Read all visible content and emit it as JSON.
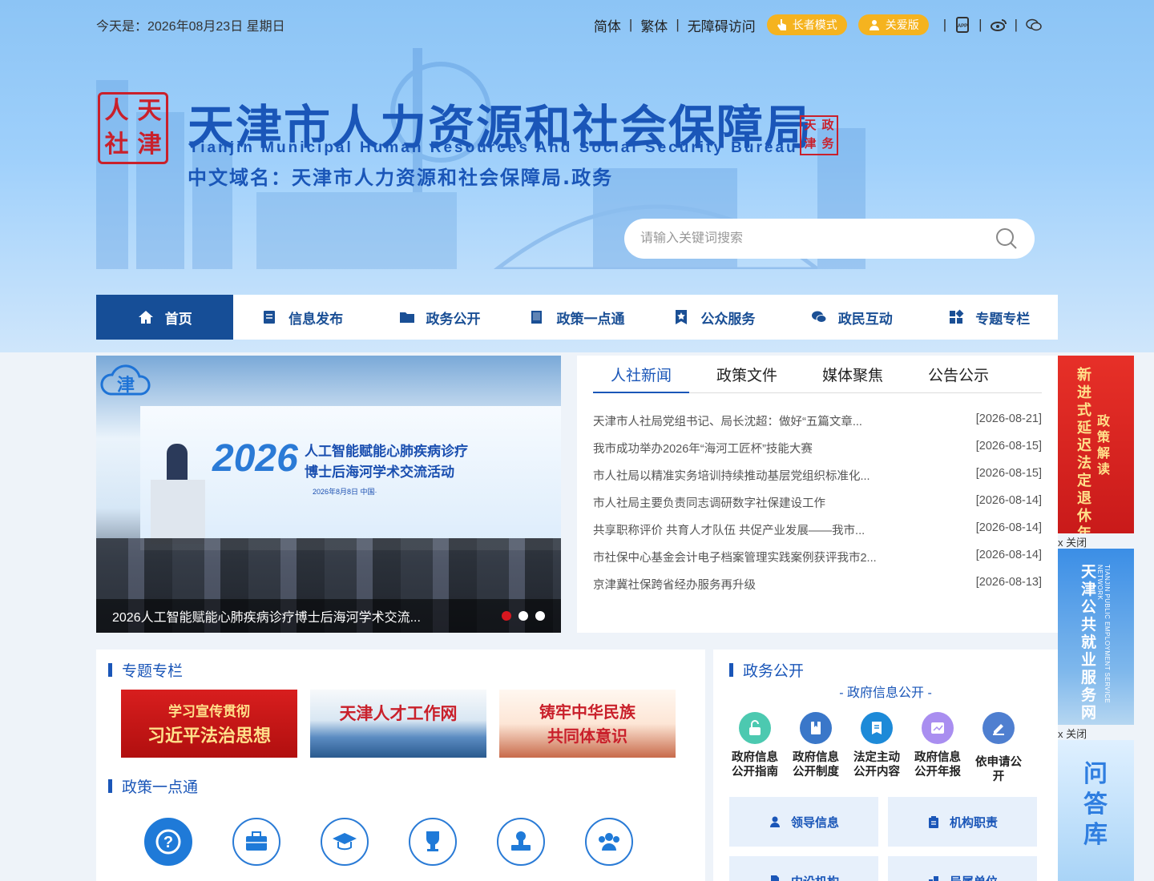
{
  "topbar": {
    "date": "今天是：2026年08月23日 星期日",
    "links": [
      "简体",
      "繁体",
      "无障碍访问"
    ],
    "elder_mode": "长者模式",
    "care_version": "关爱版"
  },
  "header": {
    "seal_chars": [
      "人",
      "天",
      "社",
      "津"
    ],
    "title": "天津市人力资源和社会保障局",
    "title_en": "Tianjin Municipal Human Resources And Social Security Bureau",
    "domain": "中文域名：天津市人力资源和社会保障局.政务",
    "stamp_chars": [
      "天",
      "政",
      "津",
      "务"
    ]
  },
  "search": {
    "placeholder": "请输入关键词搜索"
  },
  "nav": {
    "items": [
      {
        "label": "首页",
        "icon": "home-icon"
      },
      {
        "label": "信息发布",
        "icon": "document-icon"
      },
      {
        "label": "政务公开",
        "icon": "folder-icon"
      },
      {
        "label": "政策一点通",
        "icon": "book-icon"
      },
      {
        "label": "公众服务",
        "icon": "star-badge-icon"
      },
      {
        "label": "政民互动",
        "icon": "chat-icon"
      },
      {
        "label": "专题专栏",
        "icon": "grid-icon"
      }
    ]
  },
  "slider": {
    "screen_year": "2026",
    "screen_line1": "人工智能赋能心肺疾病诊疗",
    "screen_line2": "博士后海河学术交流活动",
    "screen_date": "2026年8月8日   中国·",
    "caption": "2026人工智能赋能心肺疾病诊疗博士后海河学术交流...",
    "logo_char": "津"
  },
  "news": {
    "tabs": [
      "人社新闻",
      "政策文件",
      "媒体聚焦",
      "公告公示"
    ],
    "items": [
      {
        "title": "天津市人社局党组书记、局长沈超：做好“五篇文章...",
        "date": "[2026-08-21]"
      },
      {
        "title": "我市成功举办2026年“海河工匠杯”技能大赛",
        "date": "[2026-08-15]"
      },
      {
        "title": "市人社局以精准实务培训持续推动基层党组织标准化...",
        "date": "[2026-08-15]"
      },
      {
        "title": "市人社局主要负责同志调研数字社保建设工作",
        "date": "[2026-08-14]"
      },
      {
        "title": "共享职称评价 共育人才队伍 共促产业发展——我市...",
        "date": "[2026-08-14]"
      },
      {
        "title": "市社保中心基金会计电子档案管理实践案例获评我市2...",
        "date": "[2026-08-14]"
      },
      {
        "title": "京津冀社保跨省经办服务再升级",
        "date": "[2026-08-13]"
      }
    ]
  },
  "side_ads": {
    "ad1_main": "新进式延迟法定退休年龄",
    "ad1_sub": "政策解读",
    "ad2_main": "天津公共就业服务网",
    "ad2_sub": "TIANJIN PUBLIC EMPLOYMENT SERVICE NETWORK",
    "ad3_main": "问答库",
    "close_label": "x  关闭"
  },
  "special": {
    "title": "专题专栏",
    "banners": [
      {
        "line1": "学习宣传贯彻",
        "line2": "习近平法治思想"
      },
      {
        "line1": "天津人才工作网"
      },
      {
        "line1": "铸牢中华民族",
        "line2": "共同体意识"
      }
    ]
  },
  "policy": {
    "title": "政策一点通",
    "items": [
      {
        "icon": "question-icon"
      },
      {
        "icon": "briefcase-icon"
      },
      {
        "icon": "graduation-cap-icon"
      },
      {
        "icon": "trophy-icon"
      },
      {
        "icon": "stamp-icon"
      },
      {
        "icon": "people-group-icon"
      }
    ]
  },
  "gov": {
    "title": "政务公开",
    "subtitle": "- 政府信息公开 -",
    "items": [
      {
        "label1": "政府信息",
        "label2": "公开指南",
        "color": "#4cc9b0",
        "icon": "lock-open-icon"
      },
      {
        "label1": "政府信息",
        "label2": "公开制度",
        "color": "#3a77c9",
        "icon": "book-mark-icon"
      },
      {
        "label1": "法定主动",
        "label2": "公开内容",
        "color": "#1d8ad8",
        "icon": "list-doc-icon"
      },
      {
        "label1": "政府信息",
        "label2": "公开年报",
        "color": "#a98ef0",
        "icon": "chart-doc-icon"
      },
      {
        "label1": "依申请公开",
        "label2": "",
        "color": "#4f7fd0",
        "icon": "pen-icon"
      }
    ],
    "buttons": [
      {
        "label": "领导信息",
        "icon": "user-icon"
      },
      {
        "label": "机构职责",
        "icon": "clipboard-icon"
      },
      {
        "label": "内设机构",
        "icon": "org-doc-icon"
      },
      {
        "label": "局属单位",
        "icon": "building-icon"
      }
    ]
  },
  "colors": {
    "primary": "#164e97",
    "accent_blue": "#1a56b8",
    "pill_yellow": "#f5b31f",
    "seal_red": "#c9202b"
  }
}
